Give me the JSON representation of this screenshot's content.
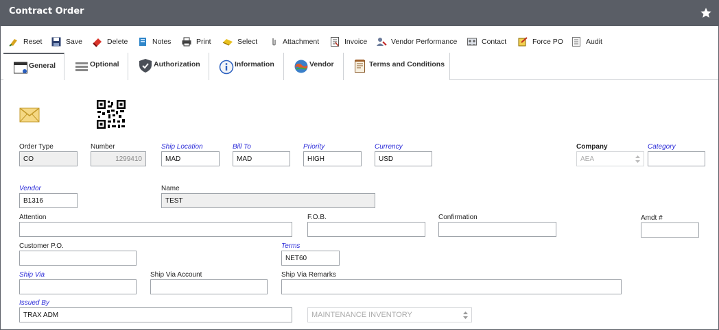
{
  "window": {
    "title": "Contract Order"
  },
  "toolbar": {
    "items": [
      {
        "label": "Reset",
        "icon": "reset-icon"
      },
      {
        "label": "Save",
        "icon": "save-icon"
      },
      {
        "label": "Delete",
        "icon": "delete-icon"
      },
      {
        "label": "Notes",
        "icon": "notes-icon"
      },
      {
        "label": "Print",
        "icon": "print-icon"
      },
      {
        "label": "Select",
        "icon": "select-icon"
      },
      {
        "label": "Attachment",
        "icon": "attachment-icon"
      },
      {
        "label": "Invoice",
        "icon": "invoice-icon"
      },
      {
        "label": "Vendor Performance",
        "icon": "vendor-performance-icon"
      },
      {
        "label": "Contact",
        "icon": "contact-icon"
      },
      {
        "label": "Force PO",
        "icon": "force-po-icon"
      },
      {
        "label": "Audit",
        "icon": "audit-icon"
      }
    ]
  },
  "tabs": [
    {
      "label": "General",
      "active": true
    },
    {
      "label": "Optional"
    },
    {
      "label": "Authorization"
    },
    {
      "label": "Information"
    },
    {
      "label": "Vendor"
    },
    {
      "label": "Terms and Conditions"
    }
  ],
  "form": {
    "order_type": {
      "label": "Order Type",
      "value": "CO"
    },
    "number": {
      "label": "Number",
      "value": "1299410"
    },
    "ship_location": {
      "label": "Ship Location",
      "value": "MAD"
    },
    "bill_to": {
      "label": "Bill To",
      "value": "MAD"
    },
    "priority": {
      "label": "Priority",
      "value": "HIGH"
    },
    "currency": {
      "label": "Currency",
      "value": "USD"
    },
    "company": {
      "label": "Company",
      "value": "AEA"
    },
    "category": {
      "label": "Category",
      "value": ""
    },
    "vendor": {
      "label": "Vendor",
      "value": "B1316"
    },
    "name": {
      "label": "Name",
      "value": "TEST"
    },
    "attention": {
      "label": "Attention",
      "value": ""
    },
    "fob": {
      "label": "F.O.B.",
      "value": ""
    },
    "confirmation": {
      "label": "Confirmation",
      "value": ""
    },
    "amdt": {
      "label": "Amdt #",
      "value": ""
    },
    "customer_po": {
      "label": "Customer P.O.",
      "value": ""
    },
    "terms": {
      "label": "Terms",
      "value": "NET60"
    },
    "ship_via": {
      "label": "Ship Via",
      "value": ""
    },
    "ship_via_account": {
      "label": "Ship Via Account",
      "value": ""
    },
    "ship_via_remarks": {
      "label": "Ship Via Remarks",
      "value": ""
    },
    "issued_by": {
      "label": "Issued By",
      "value": "TRAX ADM"
    },
    "inventory_type": {
      "value": "MAINTENANCE INVENTORY"
    }
  },
  "colors": {
    "title_bar": "#5a5e66",
    "required_label": "#2a2ad8"
  }
}
